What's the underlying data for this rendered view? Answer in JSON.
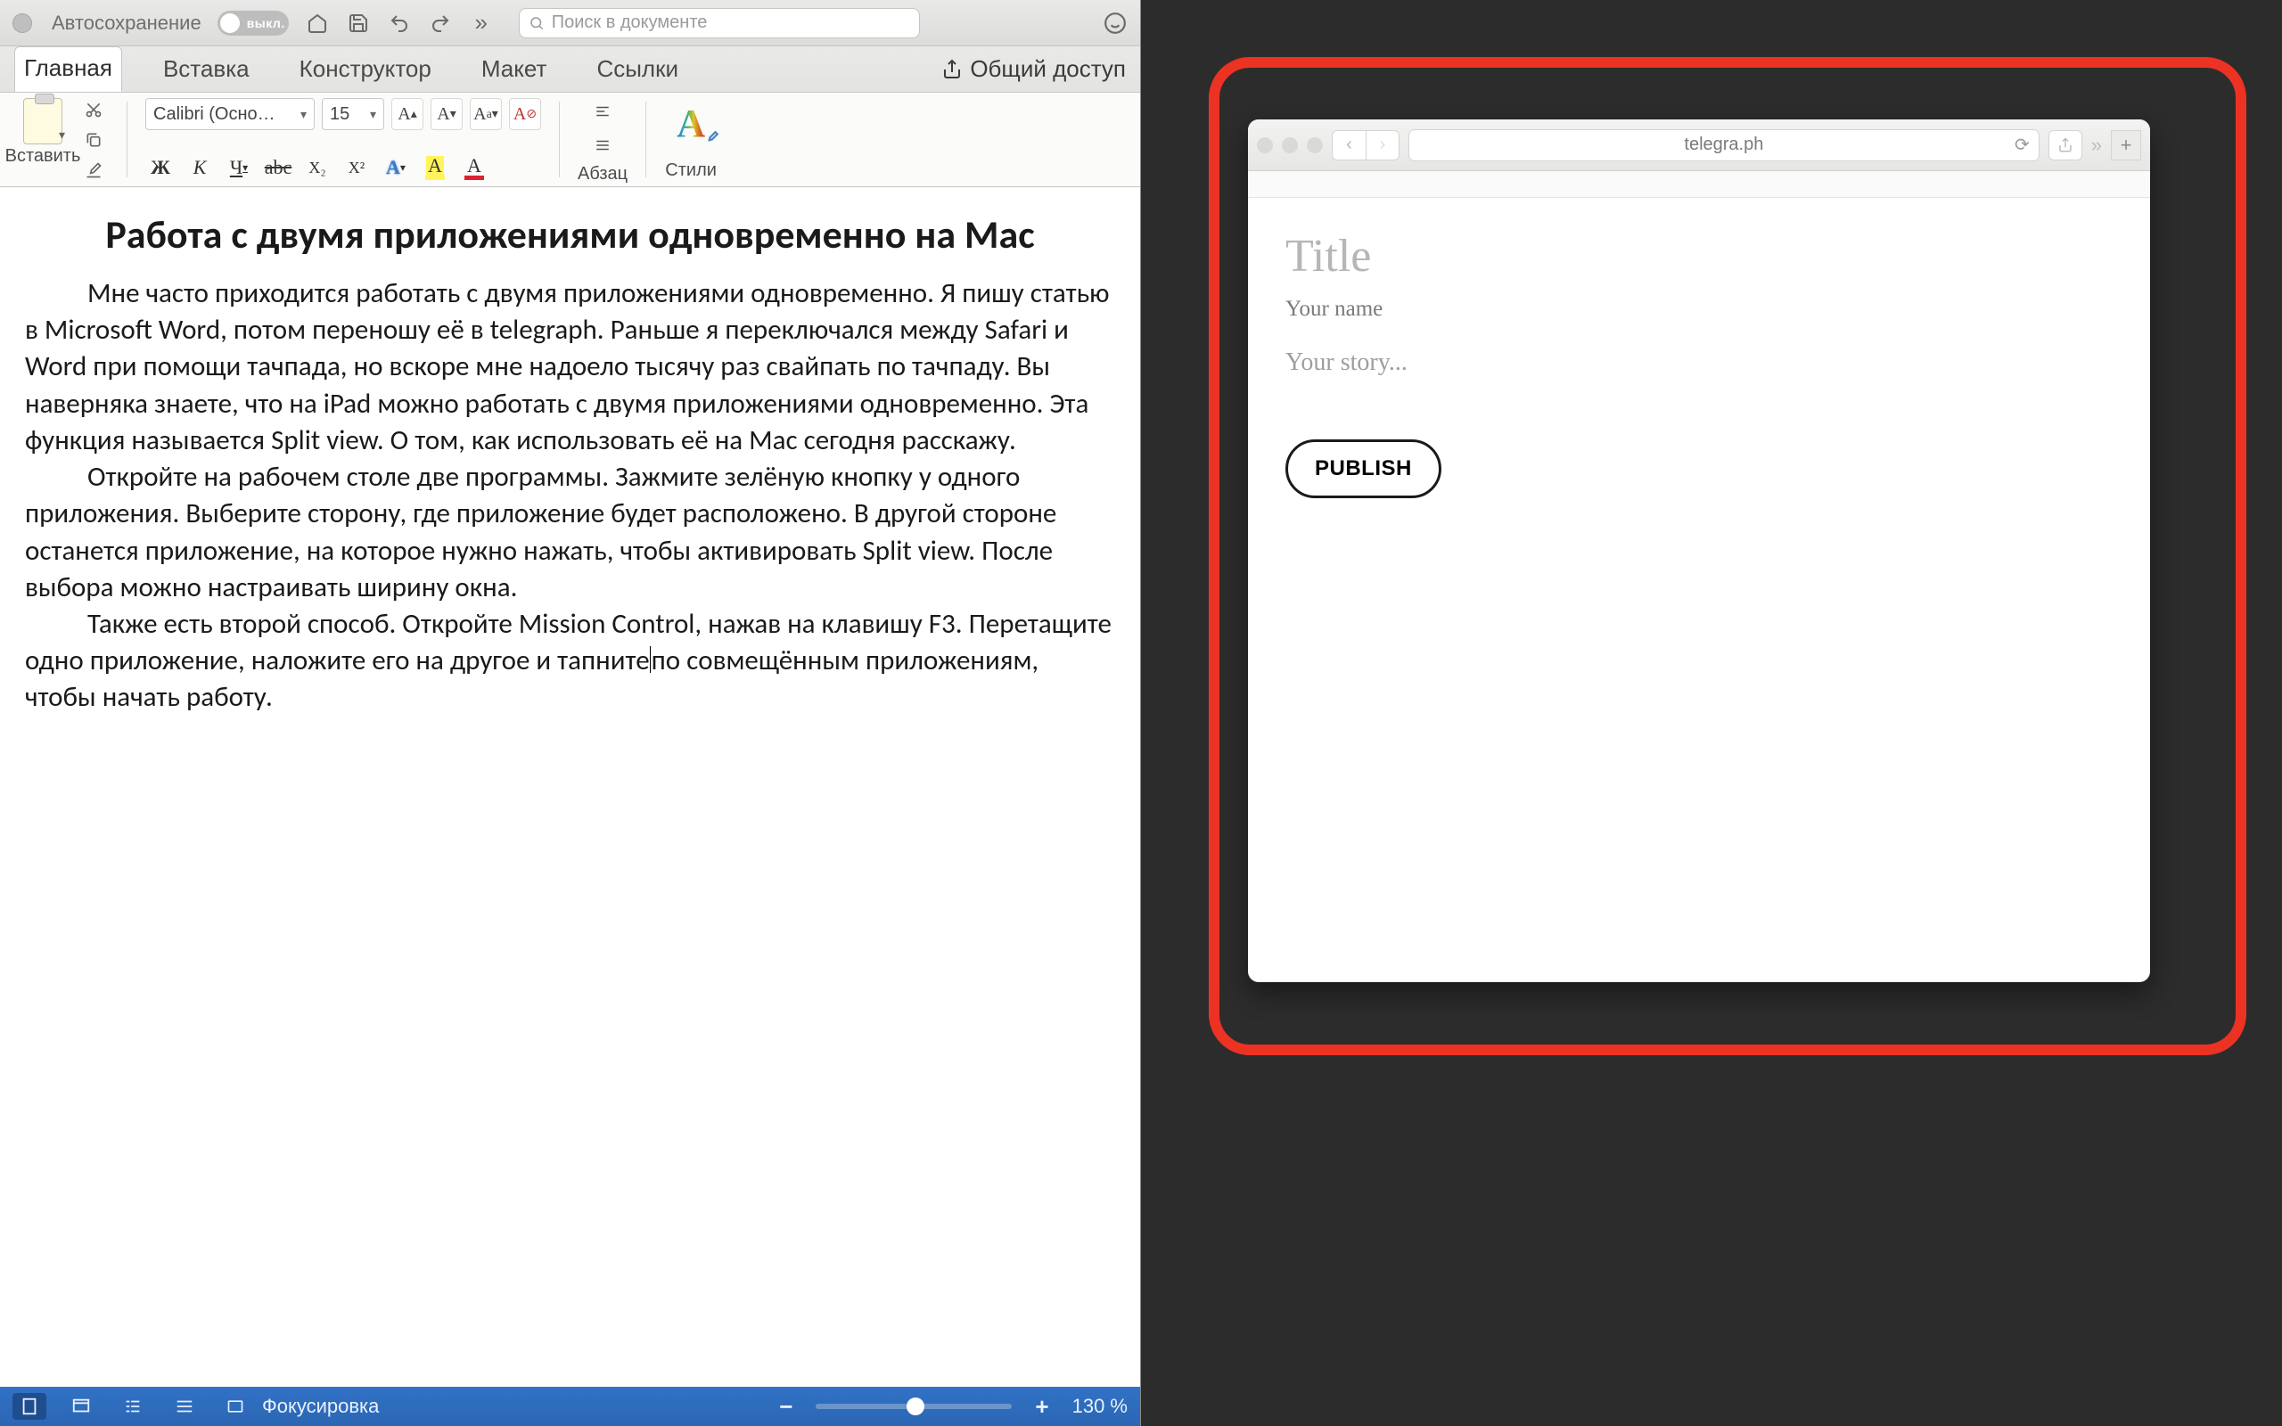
{
  "word": {
    "titlebar": {
      "autosave_label": "Автосохранение",
      "autosave_state": "выкл.",
      "search_placeholder": "Поиск в документе"
    },
    "tabs": {
      "home": "Главная",
      "insert": "Вставка",
      "design": "Конструктор",
      "layout": "Макет",
      "references": "Ссылки",
      "share": "Общий доступ"
    },
    "ribbon": {
      "paste": "Вставить",
      "font_name": "Calibri (Осно…",
      "font_size": "15",
      "paragraph": "Абзац",
      "styles": "Стили",
      "bold": "Ж",
      "italic": "К",
      "underline": "Ч",
      "strike": "abc",
      "subscript": "X₂",
      "superscript": "X²",
      "text_effect": "A",
      "highlight": "A",
      "font_color": "A"
    },
    "document": {
      "title": "Работа с двумя приложениями одновременно на Mac",
      "p1": "Мне часто приходится работать с двумя приложениями одновременно. Я пишу статью в Microsoft Word, потом переношу её в telegraph. Раньше я переключался между Safari и Word при помощи тачпада, но вскоре мне надоело тысячу раз свайпать по тачпаду. Вы наверняка знаете, что на iPad можно работать с двумя приложениями одновременно. Эта функция называется Split view. О том, как использовать её на Mac сегодня расскажу.",
      "p2": "Откройте на рабочем столе две программы. Зажмите зелёную кнопку у одного приложения. Выберите сторону, где приложение будет расположено. В другой стороне останется приложение, на которое нужно нажать, чтобы активировать Split view. После выбора можно настраивать ширину окна.",
      "p3a": "Также есть второй способ. Откройте Mission Control, нажав на клавишу F3. Перетащите одно приложение, наложите его на другое и тапните",
      "p3b": "по совмещённым приложениям, чтобы начать работу."
    },
    "statusbar": {
      "focus": "Фокусировка",
      "zoom": "130 %"
    }
  },
  "safari": {
    "address": "telegra.ph",
    "telegraph": {
      "title_placeholder": "Title",
      "name_placeholder": "Your name",
      "story_placeholder": "Your story...",
      "publish": "PUBLISH"
    }
  }
}
